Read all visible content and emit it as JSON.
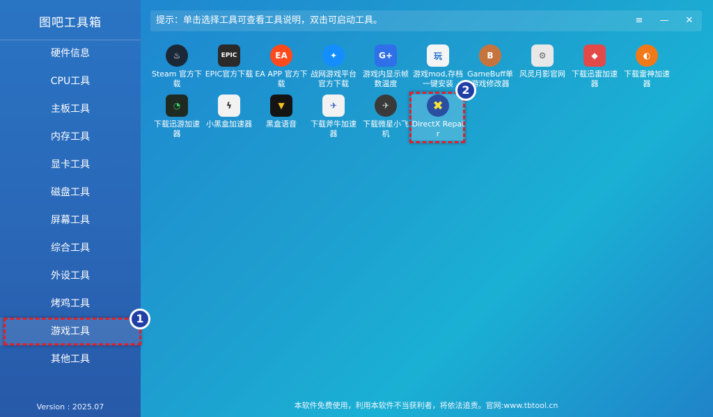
{
  "app": {
    "title": "图吧工具箱",
    "version": "Version : 2025.07"
  },
  "hint": {
    "text": "提示：单击选择工具可查看工具说明，双击可启动工具。"
  },
  "window": {
    "menu": "≡",
    "minimize": "—",
    "close": "✕"
  },
  "sidebar": {
    "items": [
      {
        "label": "硬件信息"
      },
      {
        "label": "CPU工具"
      },
      {
        "label": "主板工具"
      },
      {
        "label": "内存工具"
      },
      {
        "label": "显卡工具"
      },
      {
        "label": "磁盘工具"
      },
      {
        "label": "屏幕工具"
      },
      {
        "label": "综合工具"
      },
      {
        "label": "外设工具"
      },
      {
        "label": "烤鸡工具"
      },
      {
        "label": "游戏工具"
      },
      {
        "label": "其他工具"
      }
    ],
    "active_index": 10
  },
  "tools": [
    {
      "label": "Steam 官方下载",
      "icon": "steam-icon",
      "glyph": "♨",
      "color": "#1b2838"
    },
    {
      "label": "EPIC官方下载",
      "icon": "epic-icon",
      "glyph": "EPIC",
      "color": "#2a2a2a"
    },
    {
      "label": "EA APP 官方下载",
      "icon": "ea-icon",
      "glyph": "EA",
      "color": "#ff4a1c"
    },
    {
      "label": "战网游戏平台官方下载",
      "icon": "battlenet-icon",
      "glyph": "✦",
      "color": "#148eff"
    },
    {
      "label": "游戏内显示帧数温度",
      "icon": "fps-overlay-icon",
      "glyph": "G+",
      "color": "#2f6fe8"
    },
    {
      "label": "游戏mod,存档一键安装",
      "icon": "mod-install-icon",
      "glyph": "玩",
      "color": "#f4f4f4"
    },
    {
      "label": "GameBuff单游戏修改器",
      "icon": "gamebuff-icon",
      "glyph": "B",
      "color": "#c6743d"
    },
    {
      "label": "风灵月影官网",
      "icon": "trainer-icon",
      "glyph": "⚙",
      "color": "#e8e8e8"
    },
    {
      "label": "下载迅雷加速器",
      "icon": "xunlei-accel-icon",
      "glyph": "◆",
      "color": "#e24a4a"
    },
    {
      "label": "下载雷神加速器",
      "icon": "leishen-icon",
      "glyph": "◐",
      "color": "#f07a1a"
    },
    {
      "label": "下载迅游加速器",
      "icon": "xunyou-icon",
      "glyph": "◔",
      "color": "#1f2a22"
    },
    {
      "label": "小黑盒加速器",
      "icon": "heybox-accel-icon",
      "glyph": "ϟ",
      "color": "#f2f2f2"
    },
    {
      "label": "黑盒语音",
      "icon": "heybox-voice-icon",
      "glyph": "▼",
      "color": "#141414"
    },
    {
      "label": "下载斧牛加速器",
      "icon": "funiu-icon",
      "glyph": "✈",
      "color": "#f2f2f2"
    },
    {
      "label": "下载微星小飞机",
      "icon": "afterburner-icon",
      "glyph": "✈",
      "color": "#3a3a3a"
    },
    {
      "label": "DirectX Repair",
      "icon": "directx-repair-icon",
      "glyph": "✖",
      "color": "#2a4fa0"
    }
  ],
  "annotations": {
    "badge1": "1",
    "badge2": "2"
  },
  "footer": {
    "text": "本软件免费使用，利用本软件不当获利者，将依法追责。官网:www.tbtool.cn"
  }
}
